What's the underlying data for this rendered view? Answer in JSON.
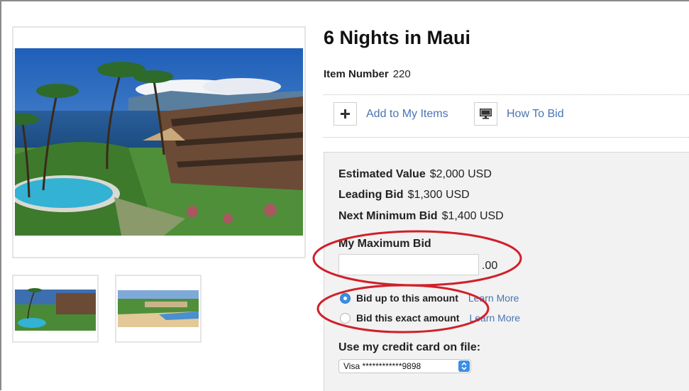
{
  "item": {
    "title": "6 Nights in Maui",
    "number_label": "Item Number",
    "number_value": "220"
  },
  "actions": {
    "add_label": "Add to My Items",
    "howto_label": "How To Bid"
  },
  "bid_info": {
    "estimated_label": "Estimated Value",
    "estimated_value": "$2,000 USD",
    "leading_label": "Leading Bid",
    "leading_value": "$1,300 USD",
    "next_label": "Next Minimum Bid",
    "next_value": "$1,400 USD"
  },
  "max_bid": {
    "label": "My Maximum Bid",
    "value": "",
    "cents": ".00"
  },
  "bid_type": {
    "options": [
      {
        "label": "Bid up to this amount",
        "learn_more": "Learn More",
        "selected": true
      },
      {
        "label": "Bid this exact amount",
        "learn_more": "Learn More",
        "selected": false
      }
    ]
  },
  "payment": {
    "label": "Use my credit card on file:",
    "selected": "Visa ************9898"
  },
  "icons": {
    "add": "plus-icon",
    "howto": "monitor-icon",
    "select_arrow": "chevron-updown-icon"
  },
  "colors": {
    "link": "#4a74b4",
    "radio_selected": "#3a8ee6",
    "annotation": "#d0202a",
    "panel_bg": "#f2f2f2"
  }
}
